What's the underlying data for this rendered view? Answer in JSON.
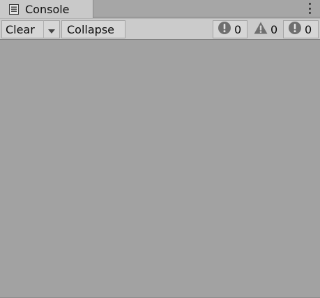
{
  "tab": {
    "title": "Console",
    "icon": "console-list-icon"
  },
  "toolbar": {
    "clear_label": "Clear",
    "collapse_label": "Collapse",
    "counters": [
      {
        "icon": "error-icon",
        "count": "0"
      },
      {
        "icon": "warning-icon",
        "count": "0"
      },
      {
        "icon": "error-icon",
        "count": "0"
      }
    ]
  },
  "colors": {
    "panel_bg": "#a1a1a1",
    "toolbar_bg": "#cbcbcb",
    "tab_active_bg": "#c9c9c9",
    "icon_gray": "#7a7a7a"
  }
}
